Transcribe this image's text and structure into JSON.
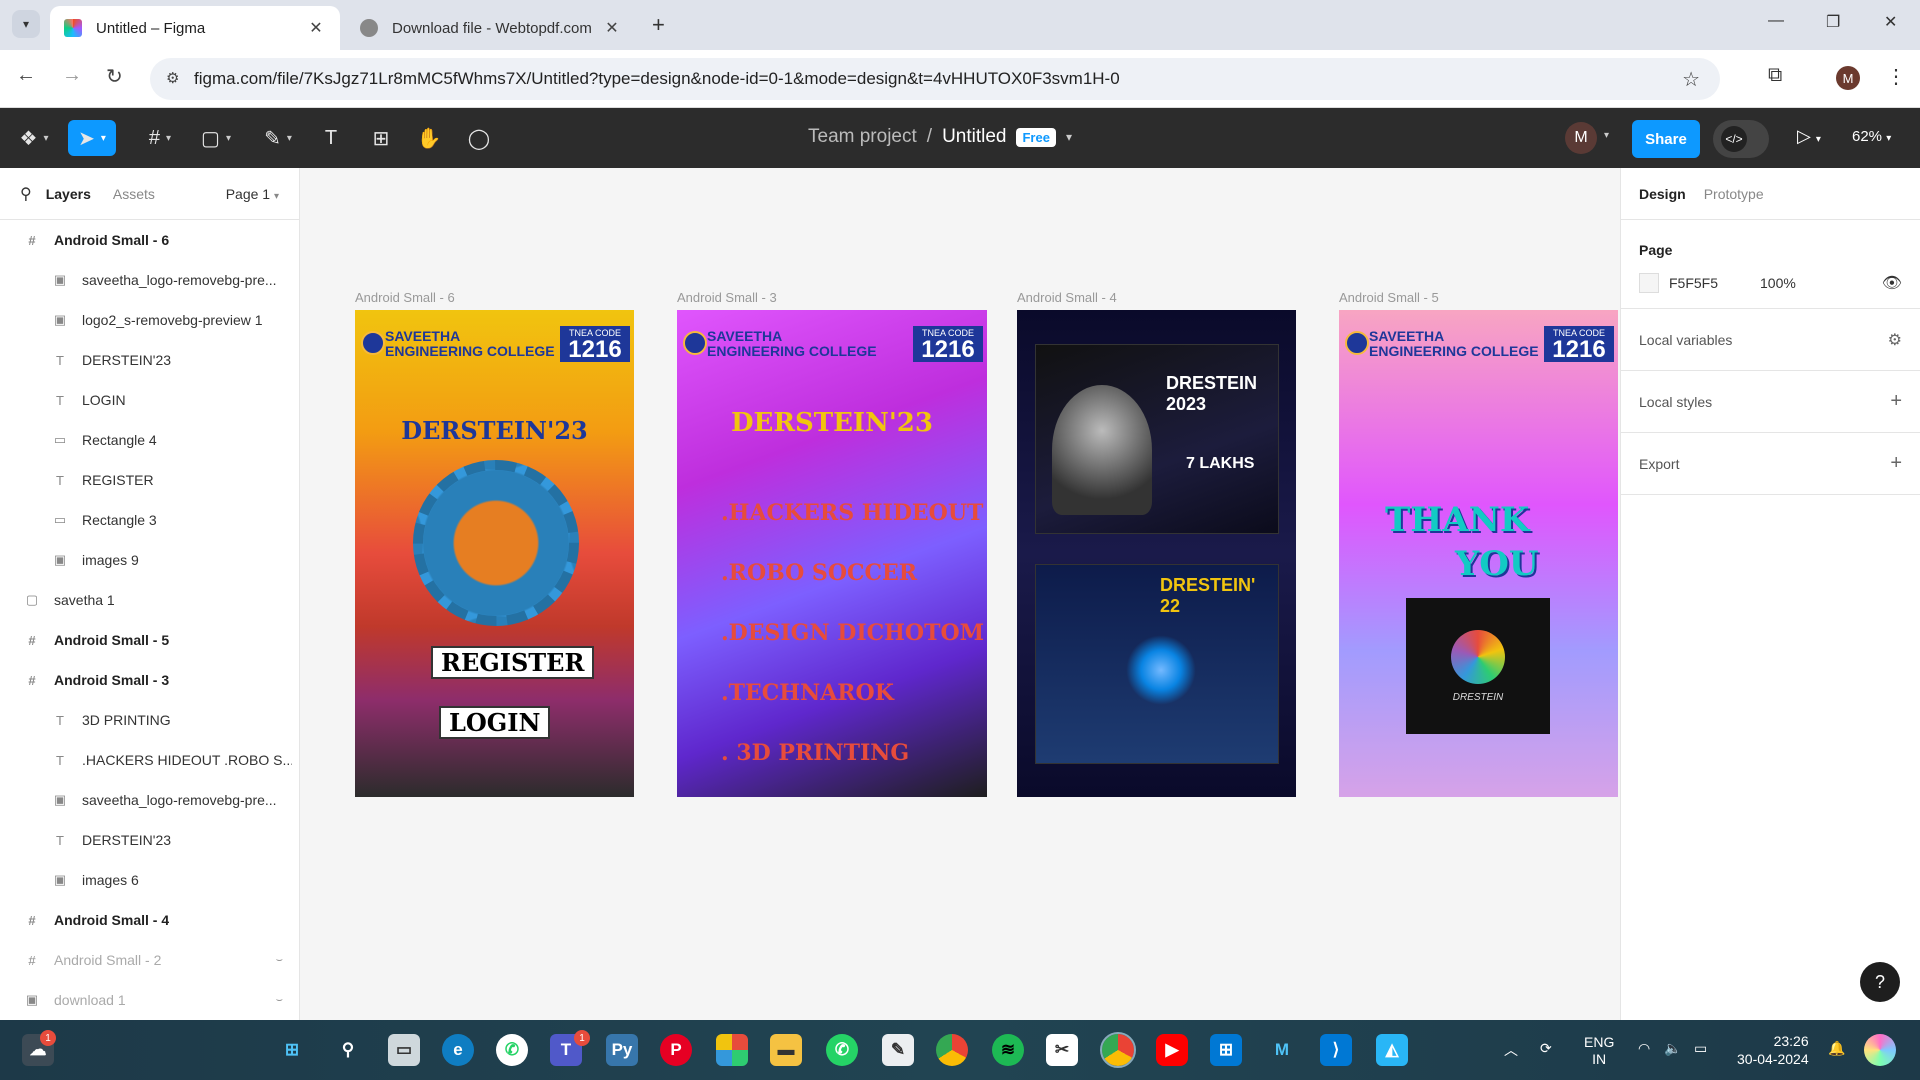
{
  "browser": {
    "tabs": [
      {
        "title": "Untitled – Figma",
        "active": true
      },
      {
        "title": "Download file - Webtopdf.com",
        "active": false
      }
    ],
    "url": "figma.com/file/7KsJgz71Lr8mMC5fWhms7X/Untitled?type=design&node-id=0-1&mode=design&t=4vHHUTOX0F3svm1H-0",
    "profile_initial": "M"
  },
  "toolbar": {
    "project": "Team project",
    "separator": "/",
    "file": "Untitled",
    "plan_badge": "Free",
    "user_initial": "M",
    "share_label": "Share",
    "zoom": "62%"
  },
  "left_panel": {
    "tab_layers": "Layers",
    "tab_assets": "Assets",
    "page_selector": "Page 1",
    "layers": [
      {
        "name": "Android Small - 6",
        "type": "frame",
        "level": 0
      },
      {
        "name": "saveetha_logo-removebg-pre...",
        "type": "image",
        "level": 1
      },
      {
        "name": "logo2_s-removebg-preview 1",
        "type": "image",
        "level": 1
      },
      {
        "name": "DERSTEIN'23",
        "type": "text",
        "level": 1
      },
      {
        "name": "LOGIN",
        "type": "text",
        "level": 1
      },
      {
        "name": "Rectangle 4",
        "type": "rect",
        "level": 1
      },
      {
        "name": "REGISTER",
        "type": "text",
        "level": 1
      },
      {
        "name": "Rectangle 3",
        "type": "rect",
        "level": 1
      },
      {
        "name": "images 9",
        "type": "image",
        "level": 1
      },
      {
        "name": "savetha 1",
        "type": "group",
        "level": 0
      },
      {
        "name": "Android Small - 5",
        "type": "frame",
        "level": 0
      },
      {
        "name": "Android Small - 3",
        "type": "frame",
        "level": 0
      },
      {
        "name": "3D PRINTING",
        "type": "text",
        "level": 1
      },
      {
        "name": ".HACKERS HIDEOUT .ROBO S...",
        "type": "text",
        "level": 1
      },
      {
        "name": "saveetha_logo-removebg-pre...",
        "type": "image",
        "level": 1
      },
      {
        "name": "DERSTEIN'23",
        "type": "text",
        "level": 1
      },
      {
        "name": "images 6",
        "type": "image",
        "level": 1
      },
      {
        "name": "Android Small - 4",
        "type": "frame",
        "level": 0
      },
      {
        "name": "Android Small - 2",
        "type": "frame",
        "level": 0,
        "hidden": true
      },
      {
        "name": "download 1",
        "type": "image",
        "level": 0,
        "hidden": true
      }
    ]
  },
  "canvas": {
    "frames": {
      "f6": {
        "label": "Android Small - 6",
        "headline": "DERSTEIN'23",
        "register": "REGISTER",
        "login": "LOGIN"
      },
      "f3": {
        "label": "Android Small - 3",
        "headline": "DERSTEIN'23",
        "events": [
          ".HACKERS HIDEOUT",
          ".ROBO SOCCER",
          ".DESIGN DICHOTOM",
          ".TECHNAROK",
          ". 3D PRINTING"
        ]
      },
      "f4": {
        "label": "Android Small - 4",
        "poster1_title": "DRESTEIN 2023",
        "poster1_prize": "7 LAKHS",
        "poster2_title": "DRESTEIN' 22"
      },
      "f5": {
        "label": "Android Small - 5",
        "thank": "THANK",
        "you": "YOU",
        "logo_text": "DRESTEIN"
      }
    },
    "college": {
      "name_line1": "SAVEETHA",
      "name_line2": "ENGINEERING COLLEGE",
      "tnea_label": "TNEA CODE",
      "tnea_code": "1216"
    }
  },
  "right_panel": {
    "tab_design": "Design",
    "tab_prototype": "Prototype",
    "page_title": "Page",
    "page_color": "F5F5F5",
    "page_opacity": "100%",
    "local_variables": "Local variables",
    "local_styles": "Local styles",
    "export": "Export"
  },
  "taskbar": {
    "lang1": "ENG",
    "lang2": "IN",
    "time": "23:26",
    "date": "30-04-2024",
    "weather_badge": "1",
    "teams_badge": "1"
  },
  "colors": {
    "figma_dark": "#2c2c2c",
    "accent": "#0d99ff",
    "canvas_bg": "#f5f5f5"
  }
}
